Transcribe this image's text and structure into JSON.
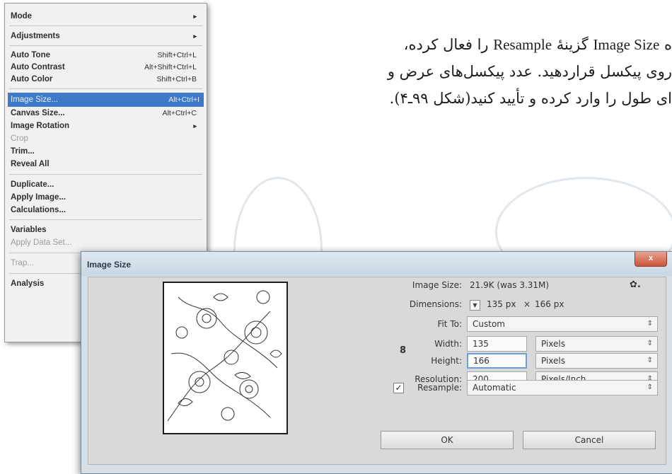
{
  "paragraph": {
    "line1_prefix": "ه ",
    "line1_latin_a": "Image Size",
    "line1_mid": " گزینۀ ",
    "line1_latin_b": "Resample",
    "line1_suffix": " را فعال کرده،",
    "line2": "روی پیکسل قراردهید. عدد پیکسل‌های عرض و",
    "line3": "ای طول را وارد کرده و تأیید کنید(شکل ۹۹ـ۴)."
  },
  "menu": {
    "items": [
      {
        "label": "Mode",
        "submenu": true
      },
      {
        "label": "Adjustments",
        "submenu": true
      },
      {
        "label": "Auto Tone",
        "shortcut": "Shift+Ctrl+L"
      },
      {
        "label": "Auto Contrast",
        "shortcut": "Alt+Shift+Ctrl+L"
      },
      {
        "label": "Auto Color",
        "shortcut": "Shift+Ctrl+B"
      },
      {
        "label": "Image Size...",
        "shortcut": "Alt+Ctrl+I"
      },
      {
        "label": "Canvas Size...",
        "shortcut": "Alt+Ctrl+C"
      },
      {
        "label": "Image Rotation",
        "submenu": true
      },
      {
        "label": "Crop"
      },
      {
        "label": "Trim..."
      },
      {
        "label": "Reveal All"
      },
      {
        "label": "Duplicate..."
      },
      {
        "label": "Apply Image..."
      },
      {
        "label": "Calculations..."
      },
      {
        "label": "Variables"
      },
      {
        "label": "Apply Data Set..."
      },
      {
        "label": "Trap..."
      },
      {
        "label": "Analysis"
      }
    ],
    "submenu_glyph": "▸"
  },
  "dialog": {
    "title": "Image Size",
    "close_glyph": "x",
    "image_size_label": "Image Size:",
    "image_size_value": "21.9K (was 3.31M)",
    "gear_glyph": "✿.",
    "dimensions_label": "Dimensions:",
    "dimensions_width": "135 px",
    "dimensions_x": "×",
    "dimensions_height": "166 px",
    "fit_to_label": "Fit To:",
    "fit_to_value": "Custom",
    "width_label": "Width:",
    "width_value": "135",
    "width_unit": "Pixels",
    "height_label": "Height:",
    "height_value": "166",
    "height_unit": "Pixels",
    "resolution_label": "Resolution:",
    "resolution_value": "200",
    "resolution_unit": "Pixels/Inch",
    "resample_label": "Resample:",
    "resample_checked_glyph": "✓",
    "resample_value": "Automatic",
    "ok_label": "OK",
    "cancel_label": "Cancel",
    "chevron_glyph": "⇕",
    "dropdown_glyph": "▼",
    "link_glyph": "8"
  },
  "colors": {
    "menu_highlight": "#3f79c8",
    "dialog_frame": "#d6dee6",
    "close_button": "#c9543a"
  }
}
